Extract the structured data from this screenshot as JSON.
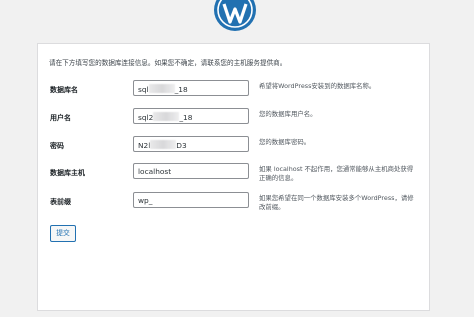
{
  "logo": {
    "name": "wordpress-logo",
    "color": "#2271b1"
  },
  "intro": "请在下方填写您的数据库连接信息。如果您不确定，请联系您的主机服务提供商。",
  "fields": [
    {
      "label": "数据库名",
      "value_prefix": "sql",
      "value_suffix": "_18",
      "masked": true,
      "help": "希望将WordPress安装到的数据库名称。"
    },
    {
      "label": "用户名",
      "value_prefix": "sql2",
      "value_suffix": "_18",
      "masked": true,
      "help": "您的数据库用户名。"
    },
    {
      "label": "密码",
      "value_prefix": "N2l",
      "value_suffix": "D3",
      "masked": true,
      "help": "您的数据库密码。"
    },
    {
      "label": "数据库主机",
      "value": "localhost",
      "help": "如果 localhost 不起作用，您通常能够从主机商处获得正确的信息。"
    },
    {
      "label": "表前缀",
      "value": "wp_",
      "help": "如果您希望在同一个数据库安装多个WordPress，请修改前缀。"
    }
  ],
  "submit_label": "提交",
  "colors": {
    "accent": "#2271b1",
    "background": "#f1f1f1",
    "card": "#ffffff"
  }
}
